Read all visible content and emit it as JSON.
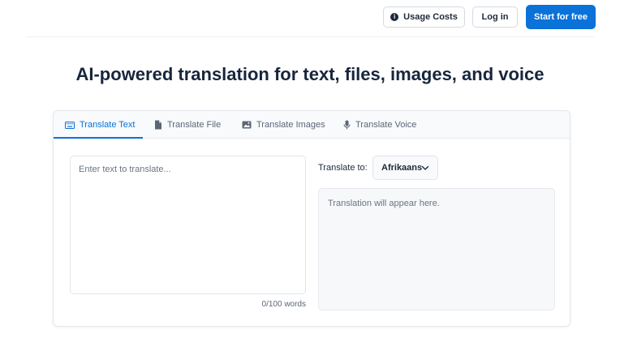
{
  "header": {
    "usage_costs_label": "Usage Costs",
    "login_label": "Log in",
    "start_label": "Start for free"
  },
  "hero": {
    "title": "AI-powered translation for text, files, images, and voice"
  },
  "tabs": [
    {
      "label": "Translate Text",
      "icon": "keyboard-icon",
      "active": true
    },
    {
      "label": "Translate File",
      "icon": "file-icon",
      "active": false
    },
    {
      "label": "Translate Images",
      "icon": "image-icon",
      "active": false
    },
    {
      "label": "Translate Voice",
      "icon": "microphone-icon",
      "active": false
    }
  ],
  "source": {
    "placeholder": "Enter text to translate...",
    "value": "",
    "word_count": "0/100 words"
  },
  "target": {
    "label": "Translate to:",
    "language": "Afrikaans",
    "output_placeholder": "Translation will appear here."
  },
  "colors": {
    "accent": "#0a72d8",
    "title": "#17263c",
    "muted": "#5a6676"
  }
}
